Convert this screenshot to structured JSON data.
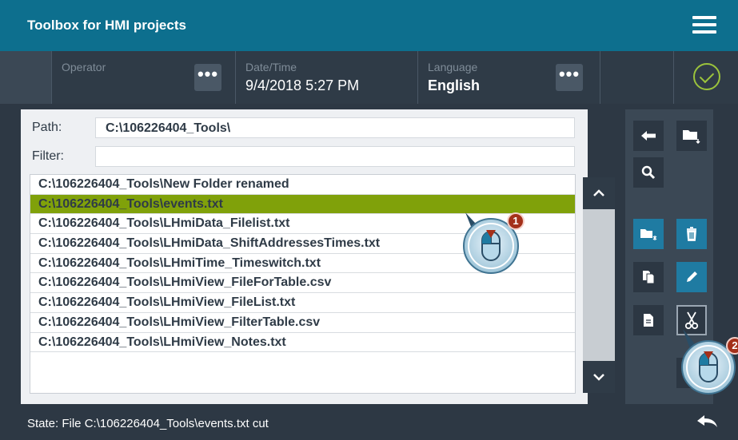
{
  "window": {
    "title": "Toolbox for HMI projects"
  },
  "header": {
    "operator_label": "Operator",
    "datetime_label": "Date/Time",
    "datetime_value": "9/4/2018 5:27 PM",
    "language_label": "Language",
    "language_value": "English",
    "dots": "•••"
  },
  "form": {
    "path_label": "Path:",
    "path_value": "C:\\106226404_Tools\\",
    "filter_label": "Filter:",
    "filter_value": ""
  },
  "files": [
    "C:\\106226404_Tools\\New Folder renamed",
    "C:\\106226404_Tools\\events.txt",
    "C:\\106226404_Tools\\LHmiData_Filelist.txt",
    "C:\\106226404_Tools\\LHmiData_ShiftAddressesTimes.txt",
    "C:\\106226404_Tools\\LHmiTime_Timeswitch.txt",
    "C:\\106226404_Tools\\LHmiView_FileForTable.csv",
    "C:\\106226404_Tools\\LHmiView_FileList.txt",
    "C:\\106226404_Tools\\LHmiView_FilterTable.csv",
    "C:\\106226404_Tools\\LHmiView_Notes.txt"
  ],
  "selected_index": 1,
  "footer": {
    "state": "State: File C:\\106226404_Tools\\events.txt cut"
  },
  "callouts": {
    "first": "1",
    "second": "2"
  },
  "icons": [
    "menu-icon",
    "check-icon",
    "arrow-left-icon",
    "folder-download-icon",
    "search-icon",
    "new-folder-icon",
    "delete-icon",
    "copy-icon",
    "edit-icon",
    "paste-icon",
    "cut-icon",
    "chevron-up-icon",
    "chevron-down-icon",
    "back-icon",
    "mouse-icon"
  ],
  "colors": {
    "titlebar": "#0d6f8e",
    "selection": "#80a10a",
    "accent_blue": "#1f7ba2",
    "ok_green": "#9bc33c",
    "callout_red": "#a4301a"
  }
}
